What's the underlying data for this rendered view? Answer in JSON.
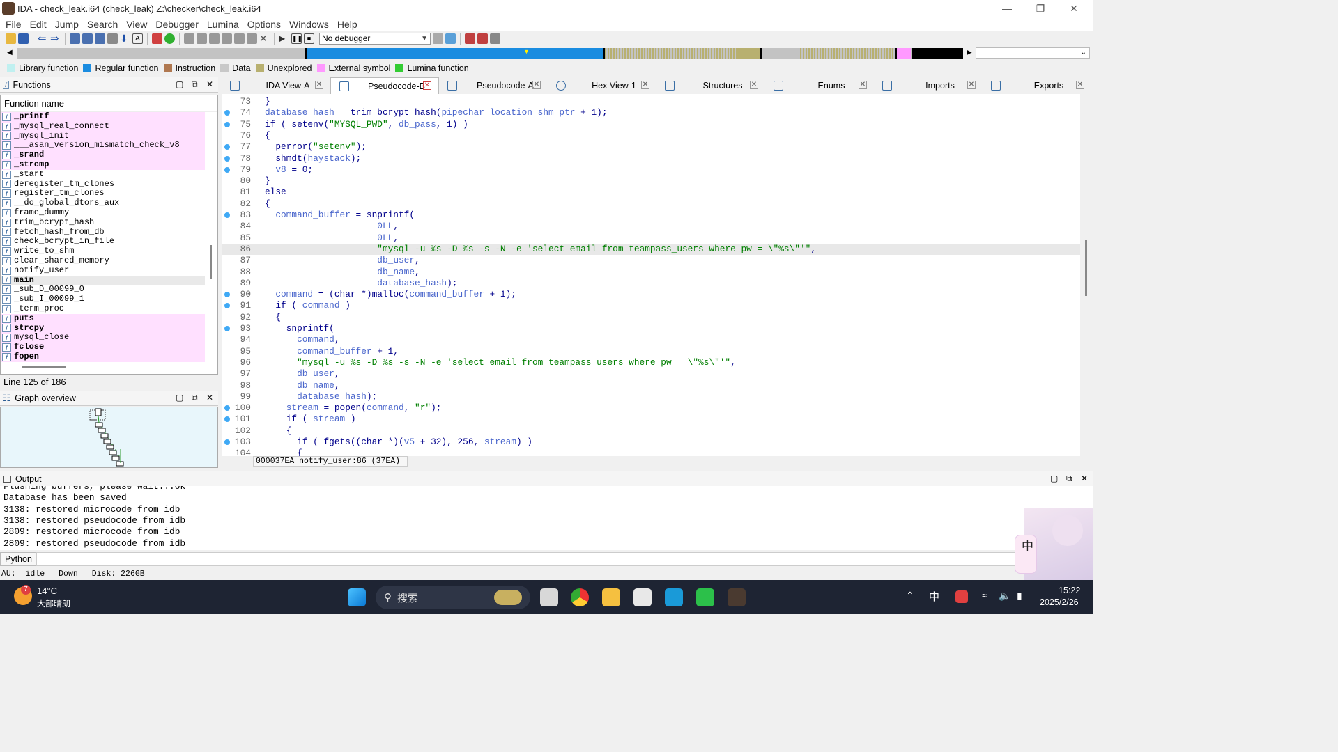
{
  "window": {
    "title": "IDA - check_leak.i64 (check_leak) Z:\\checker\\check_leak.i64"
  },
  "menu": [
    "File",
    "Edit",
    "Jump",
    "Search",
    "View",
    "Debugger",
    "Lumina",
    "Options",
    "Windows",
    "Help"
  ],
  "toolbar": {
    "debugger_label": "No debugger"
  },
  "legend": [
    {
      "label": "Library function",
      "color": "#c0f0f0"
    },
    {
      "label": "Regular function",
      "color": "#1a8ce0"
    },
    {
      "label": "Instruction",
      "color": "#b07850"
    },
    {
      "label": "Data",
      "color": "#c8c8c8"
    },
    {
      "label": "Unexplored",
      "color": "#b8b070"
    },
    {
      "label": "External symbol",
      "color": "#ff99ff"
    },
    {
      "label": "Lumina function",
      "color": "#33cc33"
    }
  ],
  "functions": {
    "panel_title": "Functions",
    "column": "Function name",
    "status": "Line 125 of 186",
    "items": [
      {
        "name": "_printf",
        "lib": true,
        "bold": true
      },
      {
        "name": "_mysql_real_connect",
        "lib": true,
        "bold": false
      },
      {
        "name": "_mysql_init",
        "lib": true,
        "bold": false
      },
      {
        "name": "___asan_version_mismatch_check_v8",
        "lib": true,
        "bold": false
      },
      {
        "name": "_srand",
        "lib": true,
        "bold": true
      },
      {
        "name": "_strcmp",
        "lib": true,
        "bold": true
      },
      {
        "name": "_start",
        "lib": false,
        "bold": false
      },
      {
        "name": "deregister_tm_clones",
        "lib": false,
        "bold": false
      },
      {
        "name": "register_tm_clones",
        "lib": false,
        "bold": false
      },
      {
        "name": "__do_global_dtors_aux",
        "lib": false,
        "bold": false
      },
      {
        "name": "frame_dummy",
        "lib": false,
        "bold": false
      },
      {
        "name": "trim_bcrypt_hash",
        "lib": false,
        "bold": false
      },
      {
        "name": "fetch_hash_from_db",
        "lib": false,
        "bold": false
      },
      {
        "name": "check_bcrypt_in_file",
        "lib": false,
        "bold": false
      },
      {
        "name": "write_to_shm",
        "lib": false,
        "bold": false
      },
      {
        "name": "clear_shared_memory",
        "lib": false,
        "bold": false
      },
      {
        "name": "notify_user",
        "lib": false,
        "bold": false
      },
      {
        "name": "main",
        "lib": false,
        "bold": true,
        "sel": true
      },
      {
        "name": "_sub_D_00099_0",
        "lib": false,
        "bold": false
      },
      {
        "name": "_sub_I_00099_1",
        "lib": false,
        "bold": false
      },
      {
        "name": "_term_proc",
        "lib": false,
        "bold": false
      },
      {
        "name": "puts",
        "lib": true,
        "bold": true
      },
      {
        "name": "strcpy",
        "lib": true,
        "bold": true
      },
      {
        "name": "mysql_close",
        "lib": true,
        "bold": false
      },
      {
        "name": "fclose",
        "lib": true,
        "bold": true
      },
      {
        "name": "fopen",
        "lib": true,
        "bold": true
      }
    ]
  },
  "graph": {
    "panel_title": "Graph overview"
  },
  "tabs": [
    {
      "label": "IDA View-A",
      "active": false
    },
    {
      "label": "Pseudocode-B",
      "active": true
    },
    {
      "label": "Pseudocode-A",
      "active": false
    },
    {
      "label": "Hex View-1",
      "active": false
    },
    {
      "label": "Structures",
      "active": false
    },
    {
      "label": "Enums",
      "active": false
    },
    {
      "label": "Imports",
      "active": false
    },
    {
      "label": "Exports",
      "active": false
    }
  ],
  "code": {
    "status": "000037EA notify_user:86 (37EA)",
    "lines": [
      {
        "n": "73",
        "t": "}",
        "dot": false
      },
      {
        "n": "74",
        "t": "database_hash = trim_bcrypt_hash(pipechar_location_shm_ptr + 1);",
        "dot": true
      },
      {
        "n": "75",
        "t": "if ( setenv(\"MYSQL_PWD\", db_pass, 1) )",
        "dot": true
      },
      {
        "n": "76",
        "t": "{",
        "dot": false
      },
      {
        "n": "77",
        "t": "  perror(\"setenv\");",
        "dot": true
      },
      {
        "n": "78",
        "t": "  shmdt(haystack);",
        "dot": true
      },
      {
        "n": "79",
        "t": "  v8 = 0;",
        "dot": true
      },
      {
        "n": "80",
        "t": "}",
        "dot": false
      },
      {
        "n": "81",
        "t": "else",
        "dot": false
      },
      {
        "n": "82",
        "t": "{",
        "dot": false
      },
      {
        "n": "83",
        "t": "  command_buffer = snprintf(",
        "dot": true
      },
      {
        "n": "84",
        "t": "                     0LL,",
        "dot": false
      },
      {
        "n": "85",
        "t": "                     0LL,",
        "dot": false
      },
      {
        "n": "86",
        "t": "                     \"mysql -u %s -D %s -s -N -e 'select email from teampass_users where pw = \\\"%s\\\"'\",",
        "dot": false,
        "cur": true
      },
      {
        "n": "87",
        "t": "                     db_user,",
        "dot": false
      },
      {
        "n": "88",
        "t": "                     db_name,",
        "dot": false
      },
      {
        "n": "89",
        "t": "                     database_hash);",
        "dot": false
      },
      {
        "n": "90",
        "t": "  command = (char *)malloc(command_buffer + 1);",
        "dot": true
      },
      {
        "n": "91",
        "t": "  if ( command )",
        "dot": true
      },
      {
        "n": "92",
        "t": "  {",
        "dot": false
      },
      {
        "n": "93",
        "t": "    snprintf(",
        "dot": true
      },
      {
        "n": "94",
        "t": "      command,",
        "dot": false
      },
      {
        "n": "95",
        "t": "      command_buffer + 1,",
        "dot": false
      },
      {
        "n": "96",
        "t": "      \"mysql -u %s -D %s -s -N -e 'select email from teampass_users where pw = \\\"%s\\\"'\",",
        "dot": false
      },
      {
        "n": "97",
        "t": "      db_user,",
        "dot": false
      },
      {
        "n": "98",
        "t": "      db_name,",
        "dot": false
      },
      {
        "n": "99",
        "t": "      database_hash);",
        "dot": false
      },
      {
        "n": "100",
        "t": "    stream = popen(command, \"r\");",
        "dot": true
      },
      {
        "n": "101",
        "t": "    if ( stream )",
        "dot": true
      },
      {
        "n": "102",
        "t": "    {",
        "dot": false
      },
      {
        "n": "103",
        "t": "      if ( fgets((char *)(v5 + 32), 256, stream) )",
        "dot": true
      },
      {
        "n": "104",
        "t": "      {",
        "dot": false
      }
    ]
  },
  "output": {
    "panel_title": "Output",
    "lines": [
      "Flushing buffers, please wait...ok",
      "Database has been saved",
      "3138: restored microcode from idb",
      "3138: restored pseudocode from idb",
      "2809: restored microcode from idb",
      "2809: restored pseudocode from idb"
    ],
    "python_label": "Python"
  },
  "statusbar": {
    "au": "AU:",
    "state": "idle",
    "dir": "Down",
    "disk": "Disk: 226GB"
  },
  "taskbar": {
    "weather_temp": "14°C",
    "weather_desc": "大部晴朗",
    "weather_badge": "7",
    "search_placeholder": "搜索",
    "ime": "中",
    "time": "15:22",
    "date": "2025/2/26"
  }
}
